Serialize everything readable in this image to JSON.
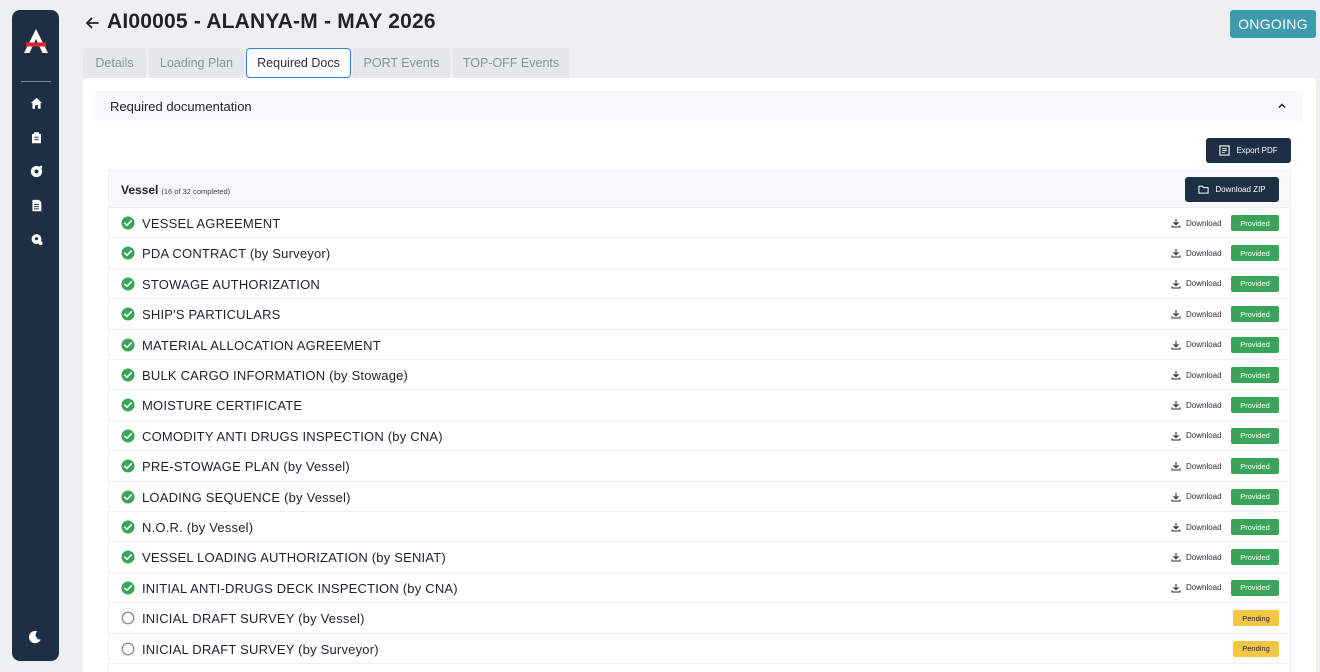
{
  "header": {
    "title": "AI00005 - ALANYA-M - MAY 2026",
    "status": "ONGOING",
    "status_color": "#3f9aad"
  },
  "sidebar": {
    "items": [
      {
        "icon": "home-icon"
      },
      {
        "icon": "clipboard-icon"
      },
      {
        "icon": "ship-wheel-icon"
      },
      {
        "icon": "documents-icon"
      },
      {
        "icon": "map-pin-icon"
      }
    ],
    "bottom_icon": "moon-icon"
  },
  "tabs": [
    {
      "label": "Details",
      "active": false
    },
    {
      "label": "Loading Plan",
      "active": false
    },
    {
      "label": "Required Docs",
      "active": true
    },
    {
      "label": "PORT Events",
      "active": false
    },
    {
      "label": "TOP-OFF Events",
      "active": false
    }
  ],
  "section": {
    "title": "Required documentation",
    "export_label": "Export PDF",
    "vessel": {
      "title": "Vessel",
      "subtitle": "(16 of 32 completed)",
      "zip_label": "Download ZIP",
      "download_label": "Download",
      "rows": [
        {
          "label": "VESSEL AGREEMENT",
          "status": "Provided"
        },
        {
          "label": "PDA CONTRACT (by Surveyor)",
          "status": "Provided"
        },
        {
          "label": "STOWAGE AUTHORIZATION",
          "status": "Provided"
        },
        {
          "label": "SHIP'S PARTICULARS",
          "status": "Provided"
        },
        {
          "label": "MATERIAL ALLOCATION AGREEMENT",
          "status": "Provided"
        },
        {
          "label": "BULK CARGO INFORMATION (by Stowage)",
          "status": "Provided"
        },
        {
          "label": "MOISTURE CERTIFICATE",
          "status": "Provided"
        },
        {
          "label": "COMODITY ANTI DRUGS INSPECTION (by CNA)",
          "status": "Provided"
        },
        {
          "label": "PRE-STOWAGE PLAN (by Vessel)",
          "status": "Provided"
        },
        {
          "label": "LOADING SEQUENCE (by Vessel)",
          "status": "Provided"
        },
        {
          "label": "N.O.R. (by Vessel)",
          "status": "Provided"
        },
        {
          "label": "VESSEL LOADING AUTHORIZATION (by SENIAT)",
          "status": "Provided"
        },
        {
          "label": "INITIAL ANTI-DRUGS DECK INSPECTION (by CNA)",
          "status": "Provided"
        },
        {
          "label": "INICIAL DRAFT SURVEY (by Vessel)",
          "status": "Pending"
        },
        {
          "label": "INICIAL DRAFT SURVEY (by Surveyor)",
          "status": "Pending"
        }
      ]
    }
  },
  "colors": {
    "sidebar": "#1c2f45",
    "provided": "#3aa55a",
    "pending": "#f2c744",
    "active_tab_border": "#3a7fd6"
  }
}
